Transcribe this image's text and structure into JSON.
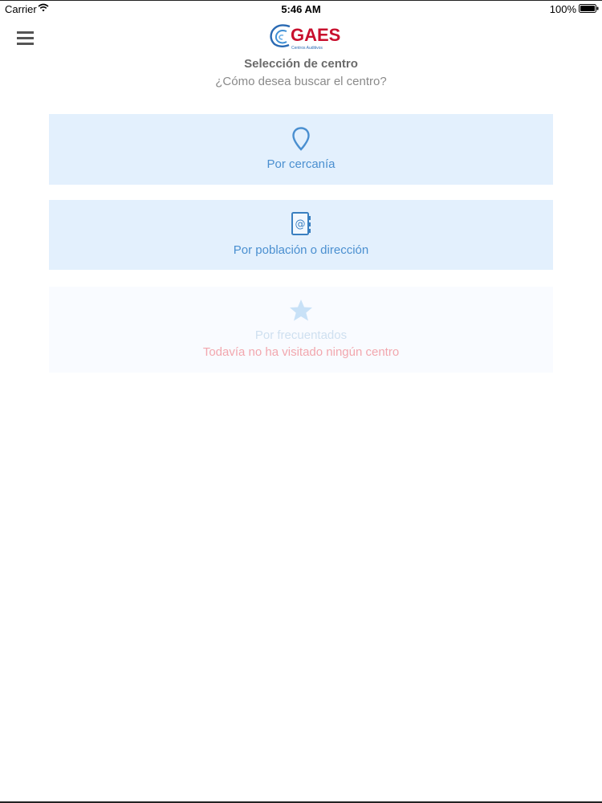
{
  "status_bar": {
    "carrier": "Carrier",
    "time": "5:46 AM",
    "battery": "100%",
    "icons": [
      "wifi-icon",
      "battery-icon"
    ]
  },
  "header": {
    "menu_icon": "hamburger-menu-icon",
    "logo": {
      "brand": "GAES",
      "tagline": "Centros Auditivos"
    },
    "title": "Selección de centro",
    "subtitle": "¿Cómo desea buscar el centro?"
  },
  "options": [
    {
      "icon": "location-pin-icon",
      "label": "Por cercanía",
      "enabled": true
    },
    {
      "icon": "address-book-icon",
      "label": "Por población o dirección",
      "enabled": true
    },
    {
      "icon": "star-icon",
      "label": "Por frecuentados",
      "note": "Todavía no ha visitado ningún centro",
      "enabled": false
    }
  ],
  "colors": {
    "card_background": "#e3f0fd",
    "disabled_card_background": "#f9fbff",
    "accent_blue": "#4a8fd0",
    "brand_red": "#c8102e",
    "warning_pink": "#f2a7ae"
  }
}
